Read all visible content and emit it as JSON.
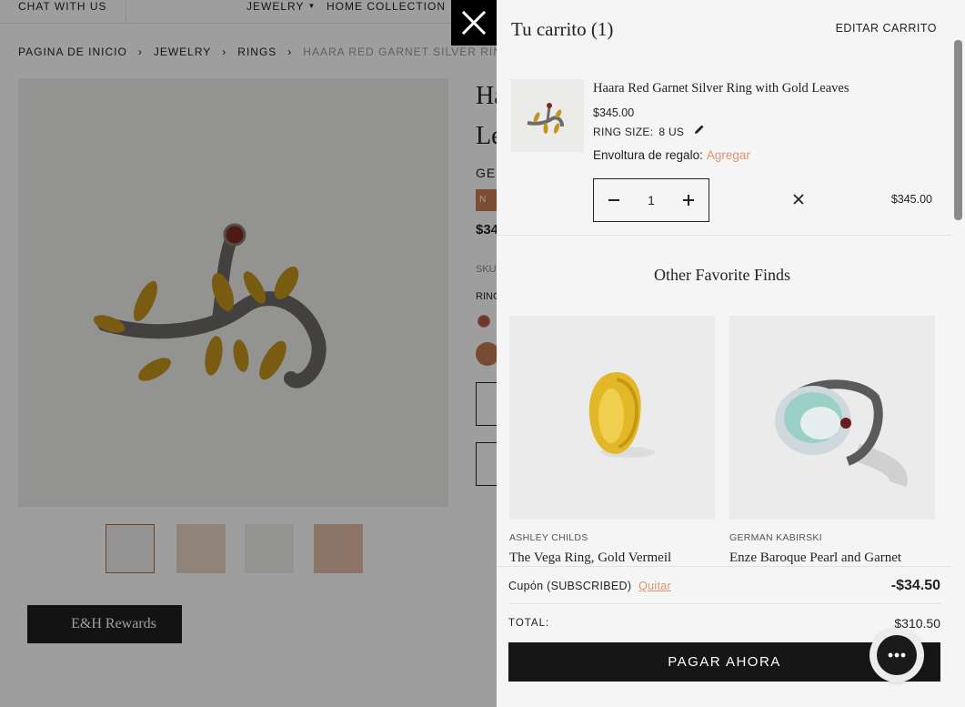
{
  "page": {
    "topbar": {
      "chat": "CHAT WITH US",
      "nav": [
        "JEWELRY",
        "HOME COLLECTION"
      ]
    },
    "breadcrumb": [
      "PAGINA DE INICIO",
      "JEWELRY",
      "RINGS",
      "HAARA RED GARNET SILVER RING"
    ],
    "product": {
      "title_line1": "Ha",
      "title_line2": "Le",
      "brand_fragment": "GE",
      "badge_fragment": "N",
      "price_fragment": "$34",
      "sku_fragment": "SKU",
      "ring_fragment": "RING"
    },
    "rewards_label": "E&H Rewards"
  },
  "cart": {
    "title": "Tu carrito (1)",
    "edit_label": "EDITAR CARRITO",
    "item": {
      "name": "Haara Red Garnet Silver Ring with Gold Leaves",
      "price": "$345.00",
      "size_label": "RING SIZE:",
      "size_value": "8 US",
      "gift_label": "Envoltura de regalo:",
      "gift_action": "Agregar",
      "quantity": "1",
      "line_total": "$345.00"
    },
    "recommendations": {
      "title": "Other Favorite Finds",
      "items": [
        {
          "brand": "ASHLEY CHILDS",
          "name": "The Vega Ring, Gold Vermeil"
        },
        {
          "brand": "GERMAN KABIRSKI",
          "name": "Enze Baroque Pearl and Garnet"
        }
      ]
    },
    "coupon": {
      "label": "Cupón (SUBSCRIBED)",
      "remove": "Quitar",
      "amount": "-$34.50"
    },
    "total_label": "TOTAL:",
    "total_amount": "$310.50",
    "checkout_label": "PAGAR AHORA"
  },
  "colors": {
    "accent": "#d9956c",
    "button": "#161616",
    "drawer_bg": "#f5f5f5"
  },
  "icons": {
    "close": "close-icon",
    "edit": "pencil-icon",
    "remove": "close-icon",
    "chat": "chat-icon"
  }
}
